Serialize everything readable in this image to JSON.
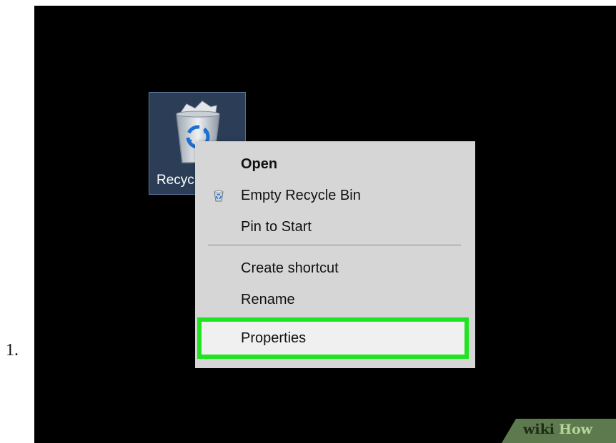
{
  "step_number": "1.",
  "desktop": {
    "icon_label": "Recycle Bin"
  },
  "context_menu": {
    "items": [
      {
        "label": "Open",
        "bold": true
      },
      {
        "label": "Empty Recycle Bin",
        "icon": "recycle-bin-icon"
      },
      {
        "label": "Pin to Start"
      },
      {
        "label": "Create shortcut"
      },
      {
        "label": "Rename"
      },
      {
        "label": "Properties",
        "highlighted": true
      }
    ]
  },
  "colors": {
    "desktop_background": "#000000",
    "menu_background": "#d6d6d6",
    "highlight_border": "#22e322",
    "icon_selection": "#2c3e57"
  },
  "watermark": {
    "part1": "wiki",
    "part2": "How"
  }
}
